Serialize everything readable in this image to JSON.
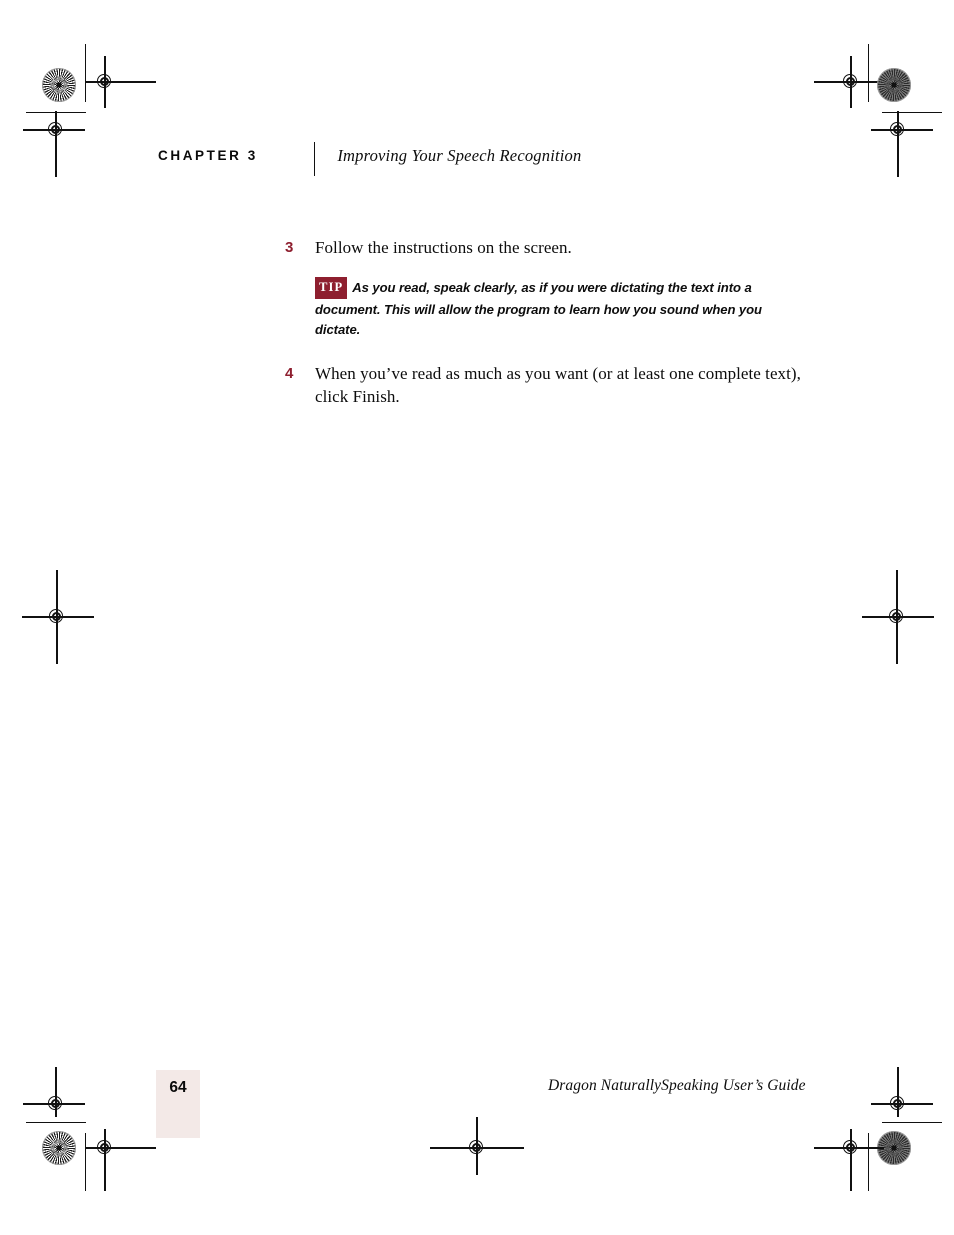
{
  "header": {
    "chapter_label": "CHAPTER 3",
    "chapter_title": "Improving Your Speech Recognition"
  },
  "body": {
    "steps": [
      {
        "number": "3",
        "text": "Follow the instructions on the screen."
      },
      {
        "number": "4",
        "text": "When you’ve read as much as you want (or at least one complete text), click Finish."
      }
    ],
    "tip": {
      "badge": "TIP",
      "text": "As you read, speak clearly, as if you were dictating the text into a document. This will allow the program to learn how you sound when you dictate."
    }
  },
  "footer": {
    "page_number": "64",
    "book_title": "Dragon NaturallySpeaking User’s Guide"
  },
  "colors": {
    "accent_red": "#8e1f2f",
    "page_number_box": "#f3e9e7",
    "text": "#0d0d0d",
    "paper": "#ffffff"
  },
  "printer_marks": {
    "star_target_label": "halftone-star-target",
    "registration_label": "registration-crosshair"
  }
}
